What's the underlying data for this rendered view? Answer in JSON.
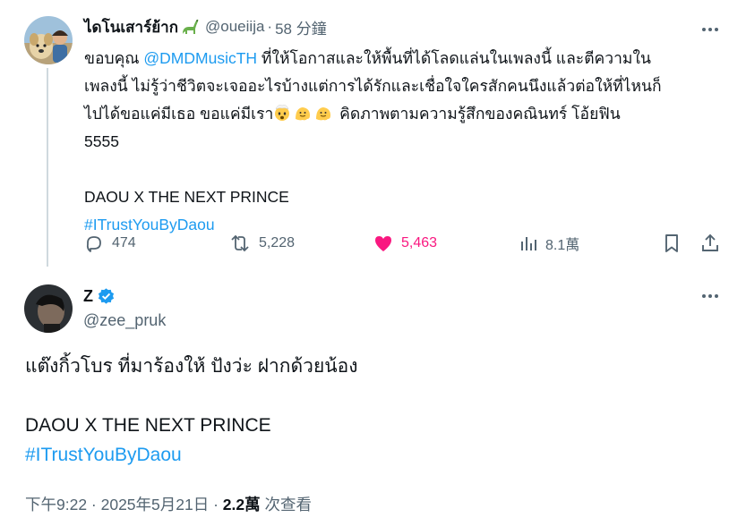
{
  "quoted_tweet": {
    "display_name": "ไดโนเสาร์ย้าก",
    "name_emoji": "sauropod-emoji",
    "handle": "@oueiija",
    "separator": "·",
    "time_ago": "58 分鐘",
    "text_line_1": "ขอบคุณ ",
    "mention": "@DMDMusicTH",
    "text_line_1b": " ที่ให้โอกาสและให้พื้นที่ได้โลดแล่นในเพลงนี้ และตีความใน",
    "text_line_2": "เพลงนี้ ไม่รู้ว่าชีวิตจะเจออะไรบ้างแต่การได้รักและเชื่อใจใครสักคนนึงแล้วต่อให้ที่ไหนก็",
    "text_line_3": "ไปได้ขอแค่มีเธอ ขอแค่มีเรา",
    "text_line_3b": " คิดภาพตามความรู้สึกของคณินทร์ โอ้ยฟิน",
    "text_line_4": "5555",
    "text_line_5": "DAOU X THE NEXT PRINCE",
    "hashtag": "#ITrustYouByDaou",
    "emojis": [
      "exploding-head-emoji",
      "melting-face-emoji",
      "melting-face-emoji"
    ],
    "stats": {
      "replies": "474",
      "reposts": "5,228",
      "likes": "5,463",
      "views": "8.1萬"
    },
    "colors": {
      "like": "#f91880",
      "link": "#1d9bf0",
      "muted": "#536471"
    }
  },
  "main_tweet": {
    "display_name": "Z",
    "verified": true,
    "handle": "@zee_pruk",
    "text_line_1": "แต๊งกิ้วโบร ที่มาร้องให้ ปังว่ะ ฝากด้วยน้อง",
    "text_line_2": "DAOU X THE NEXT PRINCE",
    "hashtag": "#ITrustYouByDaou",
    "timestamp": "下午9:22 · 2025年5月21日 · ",
    "views_count": "2.2萬",
    "views_label": " 次查看",
    "colors": {
      "verified": "#1d9bf0"
    }
  }
}
